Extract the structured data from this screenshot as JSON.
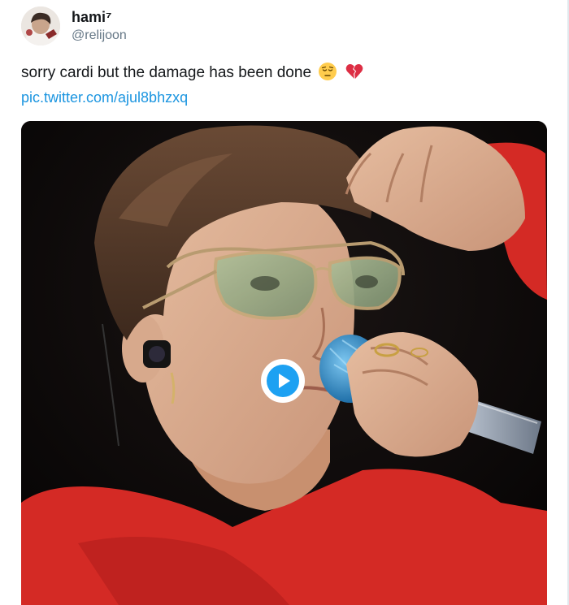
{
  "tweet": {
    "display_name": "hami⁷",
    "handle": "@relijoon",
    "text": "sorry cardi but the damage has been done",
    "emojis": [
      "pensive-face-emoji",
      "broken-heart-emoji"
    ],
    "link": "pic.twitter.com/ajul8bhzxq"
  },
  "media": {
    "type": "video",
    "play_icon": "play-icon"
  },
  "colors": {
    "link": "#1b95e0",
    "play_button": "#1da1f2",
    "hoodie": "#d42a25",
    "broken_heart": "#e0245e"
  }
}
